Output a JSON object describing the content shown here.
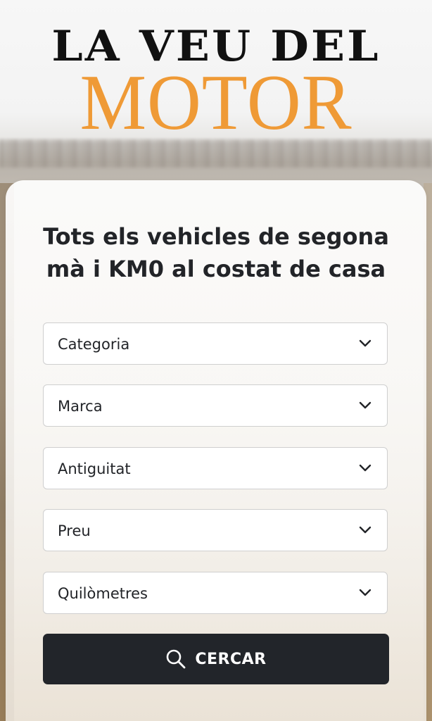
{
  "logo": {
    "line1": "LA VEU DEL",
    "line2": "MOTOR",
    "accent_color": "#ef9a36"
  },
  "headline": "Tots els vehicles de segona mà i KM0 al costat de casa",
  "filters": [
    {
      "label": "Categoria",
      "icon": "chevron-down-icon"
    },
    {
      "label": "Marca",
      "icon": "chevron-down-icon"
    },
    {
      "label": "Antiguitat",
      "icon": "chevron-down-icon"
    },
    {
      "label": "Preu",
      "icon": "chevron-down-icon"
    },
    {
      "label": "Quilòmetres",
      "icon": "chevron-down-icon"
    }
  ],
  "search_button": {
    "label": "CERCAR",
    "icon": "search-icon",
    "color": "#22252a"
  }
}
